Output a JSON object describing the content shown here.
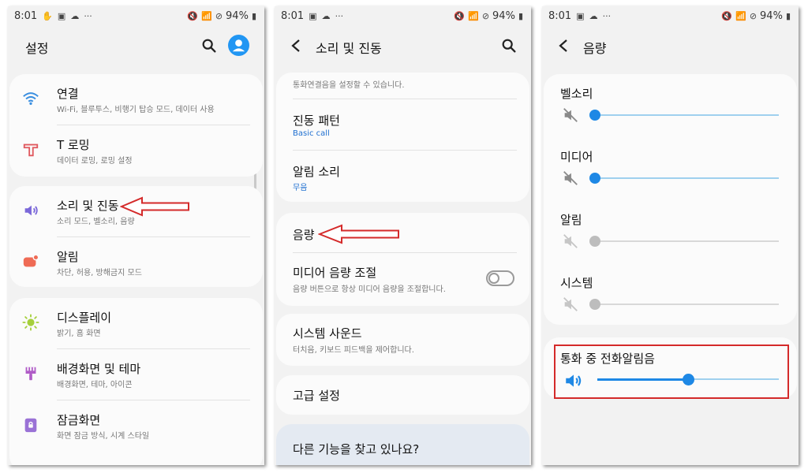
{
  "status": {
    "time": "8:01",
    "battery": "94%"
  },
  "p1": {
    "title": "설정",
    "items": [
      {
        "title": "연결",
        "sub": "Wi-Fi, 블루투스, 비행기 탑승 모드, 데이터 사용"
      },
      {
        "title": "T 로밍",
        "sub": "데이터 로밍, 로밍 설정"
      },
      {
        "title": "소리 및 진동",
        "sub": "소리 모드, 벨소리, 음량"
      },
      {
        "title": "알림",
        "sub": "차단, 허용, 방해금지 모드"
      },
      {
        "title": "디스플레이",
        "sub": "밝기, 홈 화면"
      },
      {
        "title": "배경화면 및 테마",
        "sub": "배경화면, 테마, 아이콘"
      },
      {
        "title": "잠금화면",
        "sub": "화면 잠금 방식, 시계 스타일"
      }
    ]
  },
  "p2": {
    "title": "소리 및 진동",
    "partial_sub": "통화연결음을 설정할 수 있습니다.",
    "items": [
      {
        "title": "진동 패턴",
        "sub": "Basic call"
      },
      {
        "title": "알림 소리",
        "sub": "무음"
      },
      {
        "title": "음량"
      },
      {
        "title": "미디어 음량 조절",
        "sub": "음량 버튼으로 항상 미디어 음량을 조절합니다."
      },
      {
        "title": "시스템 사운드",
        "sub": "터치음, 키보드 피드백을 제어합니다."
      },
      {
        "title": "고급 설정"
      },
      {
        "title": "다른 기능을 찾고 있나요?"
      }
    ],
    "media_volume_toggle": false
  },
  "p3": {
    "title": "음량",
    "sliders": [
      {
        "label": "벨소리",
        "value": 0,
        "muted": true,
        "enabled": true
      },
      {
        "label": "미디어",
        "value": 0,
        "muted": true,
        "enabled": true
      },
      {
        "label": "알림",
        "value": 0,
        "muted": true,
        "enabled": false
      },
      {
        "label": "시스템",
        "value": 0,
        "muted": true,
        "enabled": false
      },
      {
        "label": "통화 중 전화알림음",
        "value": 0.5,
        "muted": false,
        "enabled": true,
        "highlighted": true
      }
    ]
  },
  "colors": {
    "accent": "#1e88e5",
    "annotation": "#d42a2a",
    "link": "#1e6fd0"
  }
}
